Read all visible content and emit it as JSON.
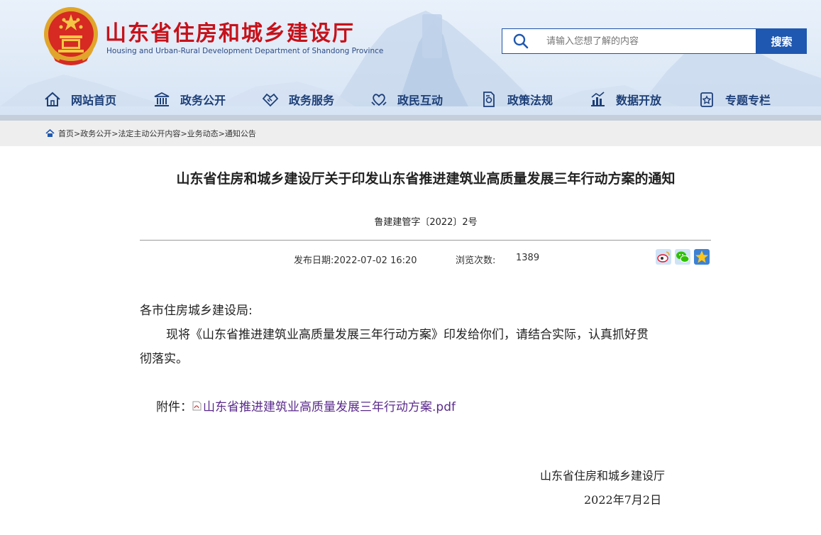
{
  "header": {
    "title": "山东省住房和城乡建设厅",
    "subtitle": "Housing and Urban-Rural Development Department of Shandong Province",
    "search_placeholder": "请输入您想了解的内容",
    "search_button": "搜索"
  },
  "nav": {
    "items": [
      {
        "label": "网站首页",
        "icon": "home-icon"
      },
      {
        "label": "政务公开",
        "icon": "government-building-icon"
      },
      {
        "label": "政务服务",
        "icon": "handshake-icon"
      },
      {
        "label": "政民互动",
        "icon": "interaction-heart-icon"
      },
      {
        "label": "政策法规",
        "icon": "policy-document-icon"
      },
      {
        "label": "数据开放",
        "icon": "data-chart-icon"
      },
      {
        "label": "专题专栏",
        "icon": "special-topic-icon"
      }
    ]
  },
  "breadcrumb": {
    "items": [
      "首页",
      "政务公开",
      "法定主动公开内容",
      "业务动态",
      "通知公告"
    ],
    "separator": ">"
  },
  "article": {
    "title": "山东省住房和城乡建设厅关于印发山东省推进建筑业高质量发展三年行动方案的通知",
    "doc_number": "鲁建建管字〔2022〕2号",
    "publish_label": "发布日期:",
    "publish_date": "2022-07-02 16:20",
    "views_label": "浏览次数:",
    "views": "1389",
    "share_icons": [
      "weibo-icon",
      "wechat-icon",
      "qzone-star-icon"
    ],
    "salutation": "各市住房城乡建设局:",
    "paragraph_line1": "现将《山东省推进建筑业高质量发展三年行动方案》印发给你们，请结合实际，认真抓好贯",
    "paragraph_line2": "彻落实。",
    "attachment_label": "附件：",
    "attachment_name": "山东省推进建筑业高质量发展三年行动方案.pdf",
    "signature": "山东省住房和城乡建设厅",
    "sign_date": "2022年7月2日"
  },
  "colors": {
    "title_red": "#c6121b",
    "nav_blue": "#1d3f78",
    "search_blue": "#1f58b0",
    "link_purple": "#5b2b8c"
  }
}
